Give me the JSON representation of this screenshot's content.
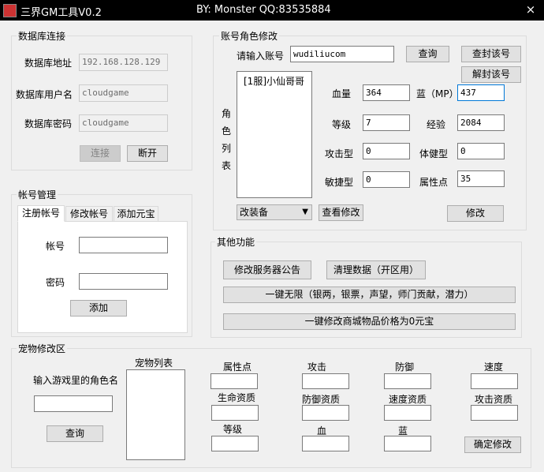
{
  "window": {
    "title": "三界GM工具V0.2",
    "author": "BY:  Monster   QQ:83535884",
    "close_icon": "×"
  },
  "db": {
    "group_label": "数据库连接",
    "address_label": "数据库地址",
    "address_value": "192.168.128.129",
    "user_label": "数据库用户名",
    "user_value": "cloudgame",
    "password_label": "数据库密码",
    "password_value": "cloudgame",
    "connect_label": "连接",
    "disconnect_label": "断开"
  },
  "account": {
    "group_label": "帐号管理",
    "tabs": [
      "注册帐号",
      "修改帐号",
      "添加元宝"
    ],
    "account_label": "帐号",
    "account_value": "",
    "password_label": "密码",
    "password_value": "",
    "add_label": "添加"
  },
  "role": {
    "group_label": "账号角色修改",
    "input_label": "请输入账号",
    "input_value": "wudiliucom",
    "query_label": "查询",
    "ban_label": "查封该号",
    "unban_label": "解封该号",
    "list_label": [
      "角",
      "色",
      "列",
      "表"
    ],
    "list_items": [
      "[1服]小仙哥哥"
    ],
    "hp_label": "血量",
    "hp_value": "364",
    "mp_label": "蓝（MP）",
    "mp_value": "437",
    "level_label": "等级",
    "level_value": "7",
    "exp_label": "经验",
    "exp_value": "2084",
    "attack_type_label": "攻击型",
    "attack_type_value": "0",
    "body_type_label": "体健型",
    "body_type_value": "0",
    "agility_label": "敏捷型",
    "agility_value": "0",
    "attr_label": "属性点",
    "attr_value": "35",
    "equip_select": "改装备",
    "view_modify_label": "查看修改",
    "modify_label": "修改"
  },
  "other": {
    "group_label": "其他功能",
    "notice_label": "修改服务器公告",
    "clear_label": "清理数据（开区用）",
    "unlimited_label": "一键无限（银两，银票，声望，师门贡献，潜力）",
    "shop_label": "一键修改商城物品价格为0元宝"
  },
  "pet": {
    "group_label": "宠物修改区",
    "role_input_label": "输入游戏里的角色名",
    "role_input_value": "",
    "query_label": "查询",
    "list_label": "宠物列表",
    "fields": [
      "属性点",
      "攻击",
      "防御",
      "速度",
      "生命资质",
      "防御资质",
      "速度资质",
      "攻击资质",
      "等级",
      "血",
      "蓝"
    ],
    "confirm_label": "确定修改"
  }
}
